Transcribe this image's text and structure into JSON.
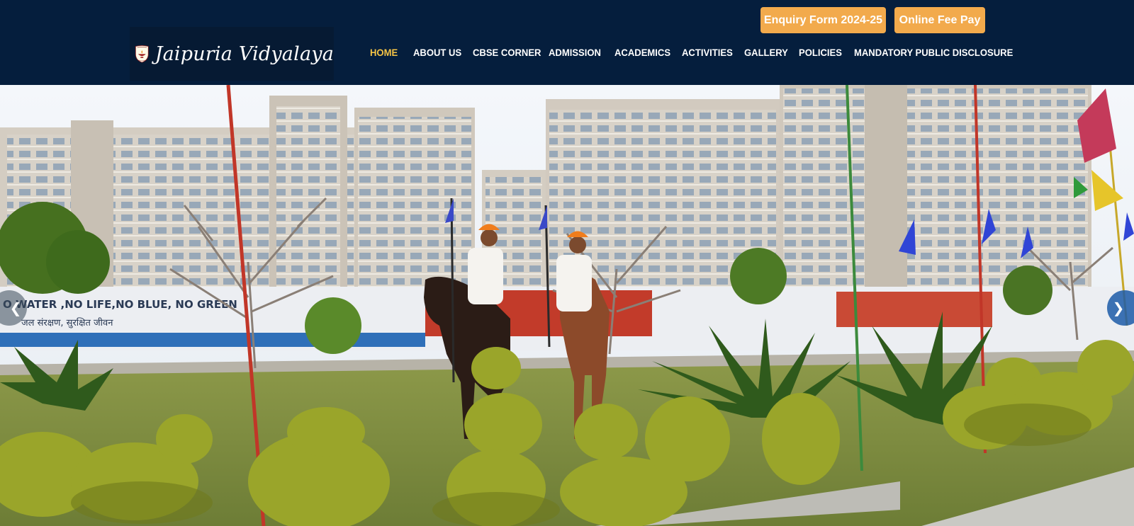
{
  "brand": {
    "name": "Jaipuria Vidyalaya",
    "logo_icon": "diya-crest-icon"
  },
  "header_buttons": {
    "enquiry": "Enquiry Form 2024-25",
    "fee": "Online Fee Pay"
  },
  "nav": {
    "items": [
      {
        "label": "HOME",
        "active": true
      },
      {
        "label": "ABOUT US",
        "active": false
      },
      {
        "label": "CBSE CORNER",
        "active": false
      },
      {
        "label": "ADMISSION",
        "active": false
      },
      {
        "label": "ACADEMICS",
        "active": false
      },
      {
        "label": "ACTIVITIES",
        "active": false
      },
      {
        "label": "GALLERY",
        "active": false
      },
      {
        "label": "POLICIES",
        "active": false
      },
      {
        "label": "MANDATORY PUBLIC DISCLOSURE",
        "active": false
      }
    ]
  },
  "hero": {
    "wall_text": "O WATER ,NO LIFE,NO BLUE, NO GREEN",
    "wall_text_hindi": "जल संरक्षण, सुरक्षित जीवन",
    "prev_icon": "chevron-left-icon",
    "next_icon": "chevron-right-icon"
  },
  "colors": {
    "header_bg": "#051e3d",
    "button_orange": "#f2aa4c",
    "nav_active": "#f6c445"
  }
}
